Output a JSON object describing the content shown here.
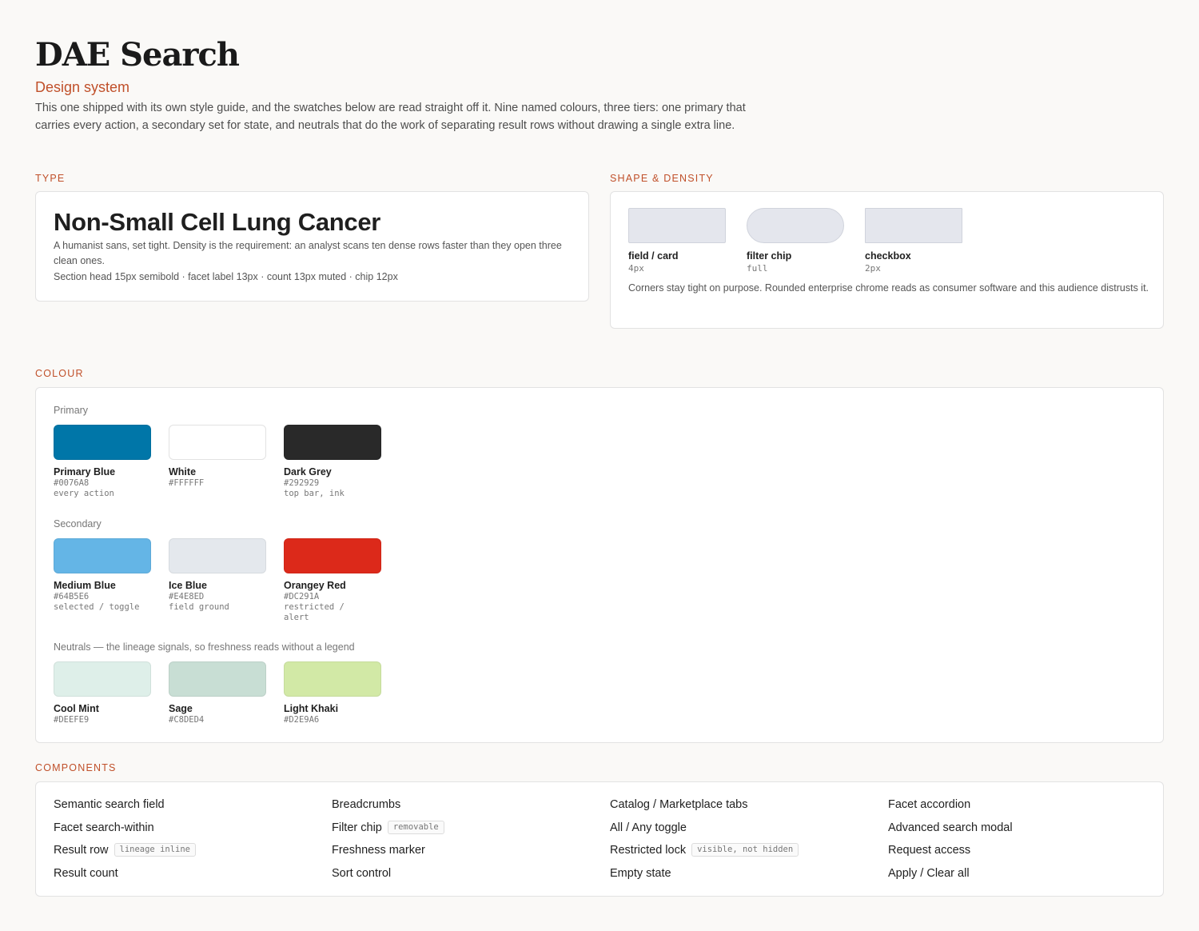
{
  "header": {
    "title": "DAE Search",
    "subtitle": "Design system",
    "intro": "This one shipped with its own style guide, and the swatches below are read straight off it. Nine named colours, three tiers: one primary that carries every action, a secondary set for state, and neutrals that do the work of separating result rows without drawing a single extra line."
  },
  "type": {
    "heading": "TYPE",
    "sample": "Non-Small Cell Lung Cancer",
    "description": "A humanist sans, set tight. Density is the requirement: an analyst scans ten dense rows faster than they open three clean ones.",
    "spec": "Section head 15px semibold · facet label 13px · count 13px muted · chip 12px"
  },
  "shape": {
    "heading": "SHAPE & DENSITY",
    "items": [
      {
        "label": "field / card",
        "value": "4px"
      },
      {
        "label": "filter chip",
        "value": "full"
      },
      {
        "label": "checkbox",
        "value": "2px"
      }
    ],
    "note": "Corners stay tight on purpose. Rounded enterprise chrome reads as consumer software and this audience distrusts it."
  },
  "colour": {
    "heading": "COLOUR",
    "groups": [
      {
        "label": "Primary",
        "swatches": [
          {
            "name": "Primary Blue",
            "hex": "#0076A8",
            "use": "every action",
            "color": "#0076A8"
          },
          {
            "name": "White",
            "hex": "#FFFFFF",
            "use": "",
            "color": "#FFFFFF"
          },
          {
            "name": "Dark Grey",
            "hex": "#292929",
            "use": "top bar, ink",
            "color": "#292929"
          }
        ]
      },
      {
        "label": "Secondary",
        "swatches": [
          {
            "name": "Medium Blue",
            "hex": "#64B5E6",
            "use": "selected / toggle",
            "color": "#64B5E6"
          },
          {
            "name": "Ice Blue",
            "hex": "#E4E8ED",
            "use": "field ground",
            "color": "#E4E8ED"
          },
          {
            "name": "Orangey Red",
            "hex": "#DC291A",
            "use": "restricted / alert",
            "color": "#DC291A"
          }
        ]
      },
      {
        "label": "Neutrals — the lineage signals, so freshness reads without a legend",
        "swatches": [
          {
            "name": "Cool Mint",
            "hex": "#DEEFE9",
            "use": "",
            "color": "#DEEFE9"
          },
          {
            "name": "Sage",
            "hex": "#C8DED4",
            "use": "",
            "color": "#C8DED4"
          },
          {
            "name": "Light Khaki",
            "hex": "#D2E9A6",
            "use": "",
            "color": "#D2E9A6"
          }
        ]
      }
    ]
  },
  "components": {
    "heading": "COMPONENTS",
    "columns": [
      [
        {
          "label": "Semantic search field",
          "tag": ""
        },
        {
          "label": "Facet search-within",
          "tag": ""
        },
        {
          "label": "Result row",
          "tag": "lineage inline"
        },
        {
          "label": "Result count",
          "tag": ""
        }
      ],
      [
        {
          "label": "Breadcrumbs",
          "tag": ""
        },
        {
          "label": "Filter chip",
          "tag": "removable"
        },
        {
          "label": "Freshness marker",
          "tag": ""
        },
        {
          "label": "Sort control",
          "tag": ""
        }
      ],
      [
        {
          "label": "Catalog / Marketplace tabs",
          "tag": ""
        },
        {
          "label": "All / Any toggle",
          "tag": ""
        },
        {
          "label": "Restricted lock",
          "tag": "visible, not hidden"
        },
        {
          "label": "Empty state",
          "tag": ""
        }
      ],
      [
        {
          "label": "Facet accordion",
          "tag": ""
        },
        {
          "label": "Advanced search modal",
          "tag": ""
        },
        {
          "label": "Request access",
          "tag": ""
        },
        {
          "label": "Apply / Clear all",
          "tag": ""
        }
      ]
    ]
  }
}
